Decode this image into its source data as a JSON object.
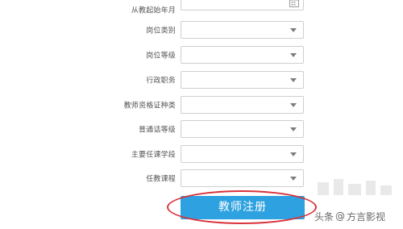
{
  "form": {
    "fields": [
      {
        "label": "从教起始年月",
        "type": "date",
        "icon": "calendar-icon"
      },
      {
        "label": "岗位类别",
        "type": "select",
        "icon": "chevron-down-icon"
      },
      {
        "label": "岗位等级",
        "type": "select",
        "icon": "chevron-down-icon"
      },
      {
        "label": "行政职务",
        "type": "select",
        "icon": "chevron-down-icon"
      },
      {
        "label": "教师资格证种类",
        "type": "select",
        "icon": "chevron-down-icon"
      },
      {
        "label": "普通话等级",
        "type": "select",
        "icon": "chevron-down-icon"
      },
      {
        "label": "主要任课学段",
        "type": "select",
        "icon": "chevron-down-icon"
      },
      {
        "label": "任教课程",
        "type": "select",
        "icon": "chevron-down-icon"
      }
    ],
    "submit_label": "教师注册"
  },
  "watermark": {
    "prefix": "头条",
    "separator": "@",
    "name": "方言影视"
  },
  "colors": {
    "button": "#2ea2e0",
    "highlight": "#d8323a",
    "border": "#cfcfcf",
    "label": "#555555"
  }
}
